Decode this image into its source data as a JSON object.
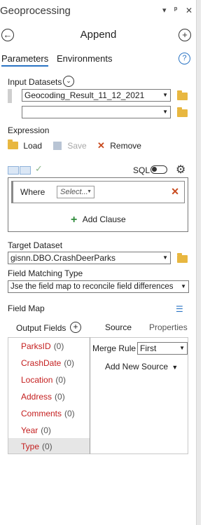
{
  "pane": {
    "title": "Geoprocessing",
    "controls": {
      "menu": "▾",
      "pin": "ᵖ",
      "close": "✕"
    }
  },
  "tool": {
    "name": "Append"
  },
  "tabs": {
    "parameters": "Parameters",
    "environments": "Environments",
    "help": "?"
  },
  "input_datasets": {
    "label": "Input Datasets",
    "values": [
      "Geocoding_Result_11_12_2021",
      ""
    ]
  },
  "expression": {
    "label": "Expression",
    "load": "Load",
    "save": "Save",
    "remove": "Remove",
    "sql_label": "SQL",
    "where_label": "Where",
    "select_placeholder": "Select...",
    "add_clause": "Add Clause"
  },
  "target_dataset": {
    "label": "Target Dataset",
    "value": "gisnn.DBO.CrashDeerParks"
  },
  "field_matching": {
    "label": "Field Matching Type",
    "value": "Jse the field map to reconcile field differences"
  },
  "field_map": {
    "label": "Field Map",
    "output_fields_label": "Output Fields",
    "fields": [
      {
        "name": "ParksID",
        "count": "(0)"
      },
      {
        "name": "CrashDate",
        "count": "(0)"
      },
      {
        "name": "Location",
        "count": "(0)"
      },
      {
        "name": "Address",
        "count": "(0)"
      },
      {
        "name": "Comments",
        "count": "(0)"
      },
      {
        "name": "Year",
        "count": "(0)"
      },
      {
        "name": "Type",
        "count": "(0)"
      }
    ],
    "source_tab": "Source",
    "properties_tab": "Properties",
    "merge_rule_label": "Merge Rule",
    "merge_rule_value": "First",
    "add_new_source": "Add New Source"
  },
  "colors": {
    "accent": "#2a74c4",
    "required": "#c41e1e",
    "folder": "#e8b740",
    "add_green": "#2e8b3a"
  }
}
